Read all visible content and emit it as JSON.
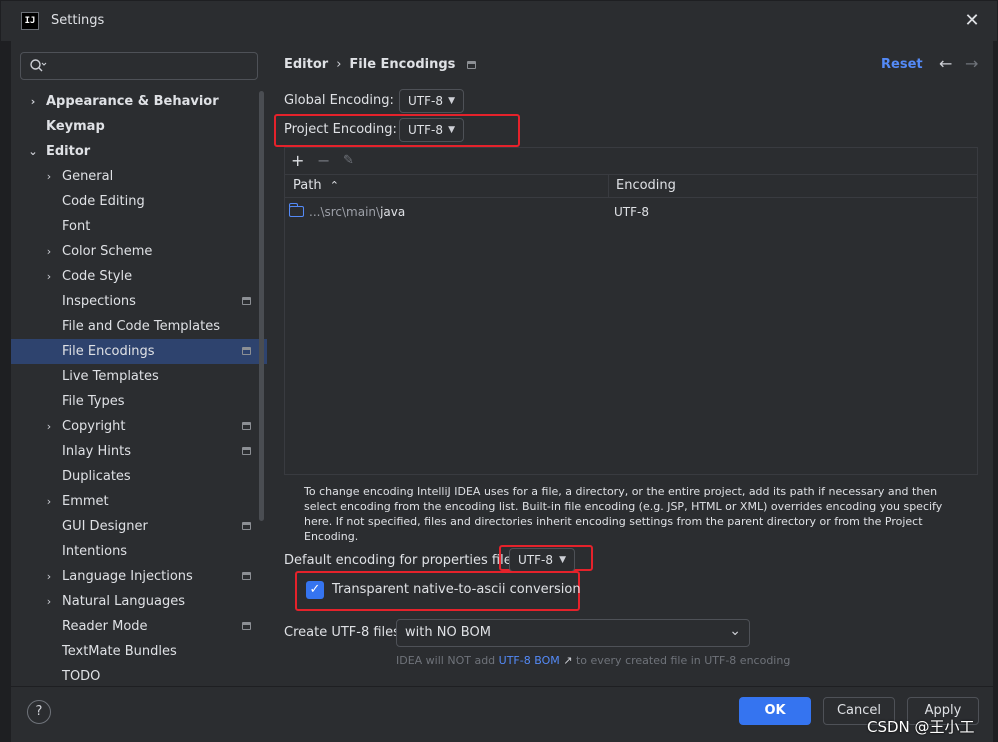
{
  "window": {
    "title": "Settings",
    "app_icon_text": "IJ",
    "close_glyph": "✕"
  },
  "search": {
    "value": "",
    "placeholder": ""
  },
  "tree": [
    {
      "label": "Appearance & Behavior",
      "level": 0,
      "bold": true,
      "arrow": "›",
      "mark": false,
      "selected": false
    },
    {
      "label": "Keymap",
      "level": 0,
      "bold": true,
      "arrow": "",
      "mark": false,
      "selected": false
    },
    {
      "label": "Editor",
      "level": 0,
      "bold": true,
      "arrow": "⌄",
      "mark": false,
      "selected": false
    },
    {
      "label": "General",
      "level": 1,
      "bold": false,
      "arrow": "›",
      "mark": false,
      "selected": false
    },
    {
      "label": "Code Editing",
      "level": 1,
      "bold": false,
      "arrow": "",
      "mark": false,
      "selected": false
    },
    {
      "label": "Font",
      "level": 1,
      "bold": false,
      "arrow": "",
      "mark": false,
      "selected": false
    },
    {
      "label": "Color Scheme",
      "level": 1,
      "bold": false,
      "arrow": "›",
      "mark": false,
      "selected": false
    },
    {
      "label": "Code Style",
      "level": 1,
      "bold": false,
      "arrow": "›",
      "mark": false,
      "selected": false
    },
    {
      "label": "Inspections",
      "level": 1,
      "bold": false,
      "arrow": "",
      "mark": true,
      "selected": false
    },
    {
      "label": "File and Code Templates",
      "level": 1,
      "bold": false,
      "arrow": "",
      "mark": false,
      "selected": false
    },
    {
      "label": "File Encodings",
      "level": 1,
      "bold": false,
      "arrow": "",
      "mark": true,
      "selected": true
    },
    {
      "label": "Live Templates",
      "level": 1,
      "bold": false,
      "arrow": "",
      "mark": false,
      "selected": false
    },
    {
      "label": "File Types",
      "level": 1,
      "bold": false,
      "arrow": "",
      "mark": false,
      "selected": false
    },
    {
      "label": "Copyright",
      "level": 1,
      "bold": false,
      "arrow": "›",
      "mark": true,
      "selected": false
    },
    {
      "label": "Inlay Hints",
      "level": 1,
      "bold": false,
      "arrow": "",
      "mark": true,
      "selected": false
    },
    {
      "label": "Duplicates",
      "level": 1,
      "bold": false,
      "arrow": "",
      "mark": false,
      "selected": false
    },
    {
      "label": "Emmet",
      "level": 1,
      "bold": false,
      "arrow": "›",
      "mark": false,
      "selected": false
    },
    {
      "label": "GUI Designer",
      "level": 1,
      "bold": false,
      "arrow": "",
      "mark": true,
      "selected": false
    },
    {
      "label": "Intentions",
      "level": 1,
      "bold": false,
      "arrow": "",
      "mark": false,
      "selected": false
    },
    {
      "label": "Language Injections",
      "level": 1,
      "bold": false,
      "arrow": "›",
      "mark": true,
      "selected": false
    },
    {
      "label": "Natural Languages",
      "level": 1,
      "bold": false,
      "arrow": "›",
      "mark": false,
      "selected": false
    },
    {
      "label": "Reader Mode",
      "level": 1,
      "bold": false,
      "arrow": "",
      "mark": true,
      "selected": false
    },
    {
      "label": "TextMate Bundles",
      "level": 1,
      "bold": false,
      "arrow": "",
      "mark": false,
      "selected": false
    },
    {
      "label": "TODO",
      "level": 1,
      "bold": false,
      "arrow": "",
      "mark": false,
      "selected": false
    }
  ],
  "header": {
    "crumb_parent": "Editor",
    "crumb_separator": "›",
    "crumb_current": "File Encodings",
    "reset_label": "Reset",
    "back_glyph": "←",
    "forward_glyph": "→"
  },
  "global_encoding": {
    "label": "Global Encoding:",
    "value": "UTF-8"
  },
  "project_encoding": {
    "label": "Project Encoding:",
    "value": "UTF-8"
  },
  "table": {
    "add_glyph": "+",
    "remove_glyph": "−",
    "edit_glyph": "✎",
    "col_path": "Path",
    "sort_glyph": "⌃",
    "col_encoding": "Encoding",
    "rows": [
      {
        "path_prefix": "...\\src\\main\\",
        "path_name": "java",
        "encoding": "UTF-8"
      }
    ]
  },
  "help_text": "To change encoding IntelliJ IDEA uses for a file, a directory, or the entire project, add its path if necessary and then select encoding from the encoding list. Built-in file encoding (e.g. JSP, HTML or XML) overrides encoding you specify here. If not specified, files and directories inherit encoding settings from the parent directory or from the Project Encoding.",
  "properties_encoding": {
    "label": "Default encoding for properties files:",
    "value": "UTF-8"
  },
  "native_to_ascii": {
    "label": "Transparent native-to-ascii conversion",
    "checked": true,
    "check_glyph": "✓"
  },
  "create_utf8": {
    "label": "Create UTF-8 files:",
    "value": "with NO BOM",
    "caret_glyph": "⌄"
  },
  "bom_hint": {
    "prefix": "IDEA will NOT add",
    "link": "UTF-8 BOM",
    "link_glyph": "↗",
    "suffix": "to every created file in UTF-8 encoding"
  },
  "buttons": {
    "help": "?",
    "ok": "OK",
    "cancel": "Cancel",
    "apply": "Apply"
  },
  "watermark": "CSDN @王小工",
  "colors": {
    "accent": "#3574f0",
    "link": "#548af7",
    "selection": "#2e436e",
    "highlight_box": "#e5222b",
    "background": "#2b2d30"
  }
}
